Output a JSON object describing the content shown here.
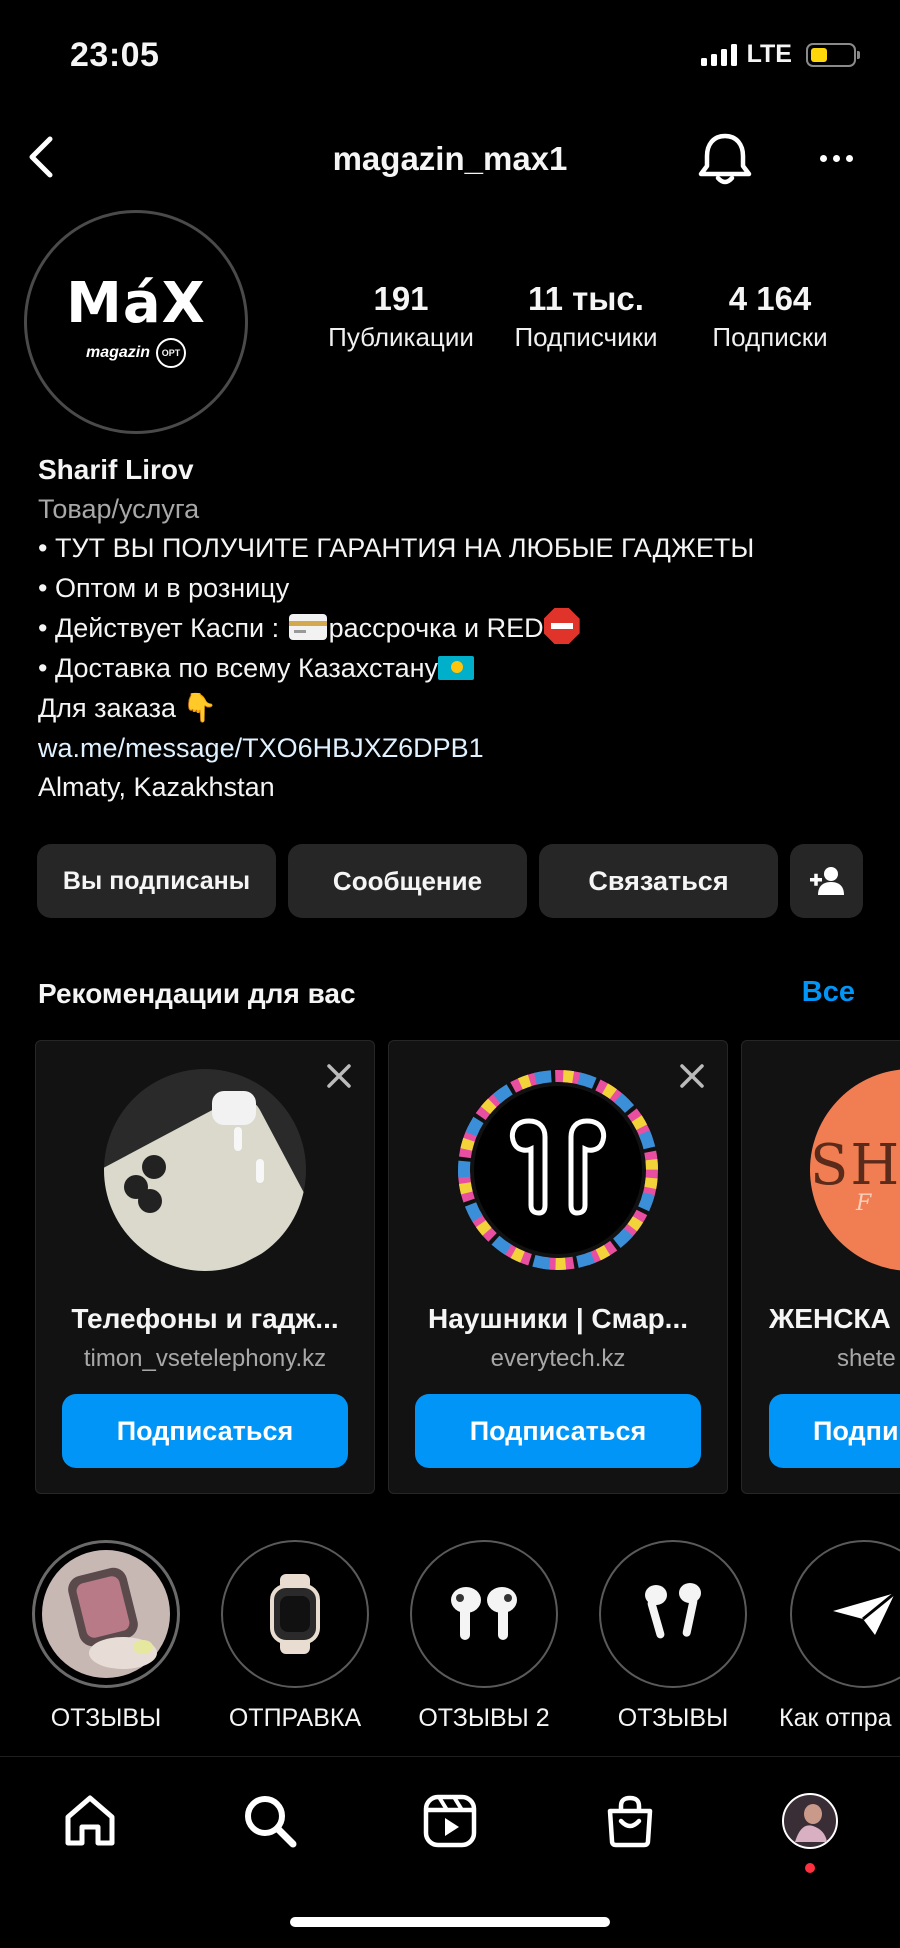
{
  "status_bar": {
    "time": "23:05",
    "network": "LTE"
  },
  "header": {
    "username": "magazin_max1"
  },
  "profile": {
    "logo_main": "MáX",
    "logo_sub": "magazin",
    "logo_badge": "OPT",
    "stats": [
      {
        "value": "191",
        "label": "Публикации"
      },
      {
        "value": "11 тыс.",
        "label": "Подписчики"
      },
      {
        "value": "4 164",
        "label": "Подписки"
      }
    ]
  },
  "bio": {
    "name": "Sharif Lirov",
    "category": "Товар/услуга",
    "line1": "• ТУТ ВЫ ПОЛУЧИТЕ ГАРАНТИЯ НА ЛЮБЫЕ ГАДЖЕТЫ",
    "line2": "• Оптом и в розницу",
    "line3_a": "• Действует Каспи : ",
    "line3_b": "рассрочка и RED",
    "line4": "• Доставка по всему Казахстану",
    "line5": "Для заказа",
    "link": "wa.me/message/TXO6HBJXZ6DPB1",
    "location": "Almaty, Kazakhstan"
  },
  "actions": {
    "subscribed": "Вы подписаны",
    "message": "Сообщение",
    "contact": "Связаться"
  },
  "recommendations": {
    "title": "Рекомендации для вас",
    "all": "Все",
    "cards": [
      {
        "name": "Телефоны и гадж...",
        "handle": "timon_vsetelephony.kz",
        "button": "Подписаться"
      },
      {
        "name": "Наушники | Смар...",
        "handle": "everytech.kz",
        "button": "Подписаться"
      },
      {
        "name": "ЖЕНСКА",
        "handle": "shete",
        "button": "Подпи",
        "logo_text": "SH",
        "logo_sub": "F"
      }
    ]
  },
  "highlights": [
    {
      "label": "ОТЗЫВЫ"
    },
    {
      "label": "ОТПРАВКА"
    },
    {
      "label": "ОТЗЫВЫ 2"
    },
    {
      "label": "ОТЗЫВЫ"
    },
    {
      "label": "Как отпра"
    }
  ],
  "colors": {
    "accent": "#0095f6",
    "background": "#000000",
    "button_bg": "#262626",
    "card_bg": "#121212",
    "notification_dot": "#ff3040"
  },
  "icons": {
    "nav": [
      "home-icon",
      "search-icon",
      "reels-icon",
      "shop-icon",
      "profile-avatar-icon"
    ],
    "header": [
      "back-icon",
      "bell-icon",
      "more-icon"
    ]
  }
}
